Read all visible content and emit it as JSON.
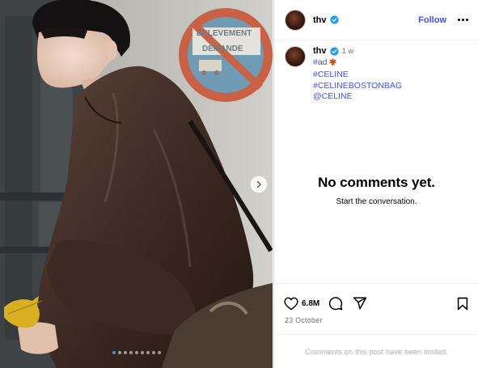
{
  "post": {
    "username": "thv",
    "follow_label": "Follow",
    "time_ago": "1 w",
    "caption_tags": [
      "#ad",
      "#CELINE",
      "#CELINEBOSTONBAG",
      "@CELINE"
    ],
    "likes": "6.8M",
    "date": "23 October",
    "carousel_count": 9,
    "carousel_active_index": 0
  },
  "media": {
    "sign_text_line1": "ENLEVEMENT",
    "sign_text_line2": "DEMANDE"
  },
  "comments": {
    "empty_title": "No comments yet.",
    "empty_subtitle": "Start the conversation.",
    "limited_notice": "Comments on this post have been limited."
  },
  "colors": {
    "link": "#4150f7",
    "verified": "#1d9bf0",
    "muted": "#737373"
  },
  "icons": [
    "chevron-right-icon",
    "verified-badge-icon",
    "more-icon",
    "leaf-icon",
    "heart-icon",
    "comment-icon",
    "share-icon",
    "bookmark-icon"
  ]
}
